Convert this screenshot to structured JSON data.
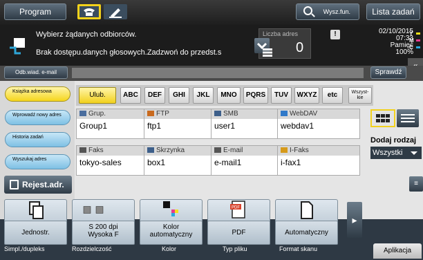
{
  "topbar": {
    "program_label": "Program",
    "search_label": "Wysz.fun.",
    "jobs_label": "Lista zadań"
  },
  "info": {
    "message_primary": "Wybierz żądanych odbiorców.",
    "message_secondary": "Brak dostępu.danych głosowych.Zadzwoń do przedst.s",
    "count_label": "Liczba adres",
    "count_value": "0",
    "warning_symbol": "!",
    "date": "02/10/2015",
    "time": "07:33",
    "memory_label": "Pamięć",
    "memory_value": "100%",
    "toner_letters": [
      "Y",
      "M",
      "C"
    ],
    "toner_colors": [
      "#f5e21a",
      "#e83b8f",
      "#2aa9e0"
    ]
  },
  "strip": {
    "email_button": "Odb.wiad. e-mail",
    "check_button": "Sprawdź"
  },
  "sidebar": {
    "items": [
      {
        "label": "Książka adresowa"
      },
      {
        "label": "Wprowadź nowy adres"
      },
      {
        "label": "Historia zadań"
      },
      {
        "label": "Wyszukaj adres"
      }
    ],
    "register_label": "Rejest.adr."
  },
  "index_tabs": [
    "Ulub.",
    "ABC",
    "DEF",
    "GHI",
    "JKL",
    "MNO",
    "PQRS",
    "TUV",
    "WXYZ",
    "etc",
    "Wszyst-kie"
  ],
  "cards": [
    {
      "type": "Grup.",
      "value": "Group1",
      "icon_color": "#4a6d9e"
    },
    {
      "type": "FTP",
      "value": "ftp1",
      "icon_color": "#c96a1e"
    },
    {
      "type": "SMB",
      "value": "user1",
      "icon_color": "#3d5f8a"
    },
    {
      "type": "WebDAV",
      "value": "webdav1",
      "icon_color": "#2f79c9"
    },
    {
      "type": "Faks",
      "value": "tokyo-sales",
      "icon_color": "#555555"
    },
    {
      "type": "Skrzynka",
      "value": "box1",
      "icon_color": "#3d5f8a"
    },
    {
      "type": "E-mail",
      "value": "e-mail1",
      "icon_color": "#555555"
    },
    {
      "type": "I-Faks",
      "value": "i-fax1",
      "icon_color": "#d69a1a"
    }
  ],
  "right_panel": {
    "type_label": "Dodaj rodzaj",
    "type_value": "Wszystki"
  },
  "functions": [
    {
      "line1": "Jednostr.",
      "line2": "",
      "caption": "Simpl./dupleks"
    },
    {
      "line1": "S 200 dpi",
      "line2": "Wysoka F",
      "caption": "Rozdzielczość"
    },
    {
      "line1": "Kolor",
      "line2": "automatyczny",
      "caption": "Kolor"
    },
    {
      "line1": "PDF",
      "line2": "",
      "caption": "Typ pliku",
      "icon_text": "PDF"
    },
    {
      "line1": "Automatyczny",
      "line2": "",
      "caption": "Format skanu"
    }
  ],
  "apps_label": "Aplikacja"
}
